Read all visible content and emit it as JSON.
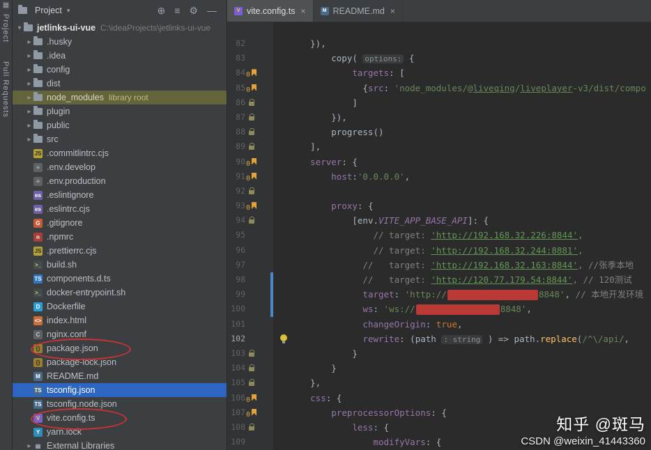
{
  "colors": {
    "sel": "#2d65c2",
    "olive": "#63633c",
    "vcs": "#4a88c7",
    "bm": "#e2a33a",
    "bulb": "#d9c13c",
    "redact": "#b93a34",
    "circle": "#cc3333"
  },
  "left_stripe": {
    "corner_glyph": "▦",
    "top_label": "Project",
    "bottom_label": "Pull Requests"
  },
  "project_panel": {
    "header": {
      "title": "Project",
      "dropdown_glyph": "▾",
      "icons": [
        {
          "name": "select-opened-file",
          "glyph": "⊕"
        },
        {
          "name": "collapse-all",
          "glyph": "≡"
        },
        {
          "name": "settings",
          "glyph": "⚙"
        },
        {
          "name": "hide-tool-window",
          "glyph": "—"
        }
      ]
    },
    "tree": [
      {
        "name": "jetlinks-ui-vue",
        "icon": "folder",
        "chevron": "down",
        "indent": 4,
        "bold": true,
        "path": "C:\\ideaProjects\\jetlinks-ui-vue"
      },
      {
        "name": ".husky",
        "icon": "folder",
        "chevron": "right",
        "indent": 18
      },
      {
        "name": ".idea",
        "icon": "folder",
        "chevron": "right",
        "indent": 18
      },
      {
        "name": "config",
        "icon": "folder",
        "chevron": "right",
        "indent": 18
      },
      {
        "name": "dist",
        "icon": "folder",
        "chevron": "right",
        "indent": 18
      },
      {
        "name": "node_modules",
        "icon": "folder",
        "chevron": "right",
        "indent": 18,
        "highlight": true,
        "suffix": "library root"
      },
      {
        "name": "plugin",
        "icon": "folder",
        "chevron": "right",
        "indent": 18
      },
      {
        "name": "public",
        "icon": "folder",
        "chevron": "right",
        "indent": 18
      },
      {
        "name": "src",
        "icon": "folder",
        "chevron": "right",
        "indent": 18
      },
      {
        "name": ".commitlintrc.cjs",
        "icon": "js",
        "indent": 18
      },
      {
        "name": ".env.develop",
        "icon": "env",
        "indent": 18
      },
      {
        "name": ".env.production",
        "icon": "env",
        "indent": 18
      },
      {
        "name": ".eslintignore",
        "icon": "eslint",
        "indent": 18
      },
      {
        "name": ".eslintrc.cjs",
        "icon": "eslint",
        "indent": 18
      },
      {
        "name": ".gitignore",
        "icon": "git",
        "indent": 18
      },
      {
        "name": ".npmrc",
        "icon": "npm",
        "indent": 18
      },
      {
        "name": ".prettierrc.cjs",
        "icon": "js",
        "indent": 18
      },
      {
        "name": "build.sh",
        "icon": "shell",
        "indent": 18
      },
      {
        "name": "components.d.ts",
        "icon": "ts",
        "indent": 18
      },
      {
        "name": "docker-entrypoint.sh",
        "icon": "shell",
        "indent": 18
      },
      {
        "name": "Dockerfile",
        "icon": "docker",
        "indent": 18
      },
      {
        "name": "index.html",
        "icon": "html",
        "indent": 18
      },
      {
        "name": "nginx.conf",
        "icon": "conf",
        "indent": 18
      },
      {
        "name": "package.json",
        "icon": "json",
        "indent": 18,
        "circled": true,
        "circle_width": 140
      },
      {
        "name": "package-lock.json",
        "icon": "json",
        "indent": 18
      },
      {
        "name": "README.md",
        "icon": "md",
        "indent": 18
      },
      {
        "name": "tsconfig.json",
        "icon": "tsconfig",
        "indent": 18,
        "selected": true
      },
      {
        "name": "tsconfig.node.json",
        "icon": "tsconfig",
        "indent": 18
      },
      {
        "name": "vite.config.ts",
        "icon": "vite",
        "indent": 18,
        "circled": true,
        "circle_width": 134
      },
      {
        "name": "yarn.lock",
        "icon": "yarn",
        "indent": 18
      },
      {
        "name": "External Libraries",
        "icon": "lib",
        "chevron": "right",
        "indent": 18
      }
    ]
  },
  "tab_bar": {
    "close_glyph": "×",
    "tabs": [
      {
        "label": "vite.config.ts",
        "icon": "vite",
        "active": true
      },
      {
        "label": "README.md",
        "icon": "md",
        "active": false
      }
    ]
  },
  "editor": {
    "bookmark_label": "0",
    "lines": [
      {
        "n": 82,
        "t": [
          [
            "p",
            "      }),"
          ]
        ]
      },
      {
        "n": 83,
        "t": [
          [
            "p",
            "          copy( "
          ],
          [
            "h",
            "options:"
          ],
          [
            "p",
            " {"
          ]
        ]
      },
      {
        "n": 84,
        "g": "bookmark",
        "t": [
          [
            "p",
            "              "
          ],
          [
            "f",
            "targets"
          ],
          [
            "p",
            ": ["
          ]
        ]
      },
      {
        "n": 85,
        "g": "bookmark",
        "t": [
          [
            "p",
            "                {"
          ],
          [
            "f",
            "src"
          ],
          [
            "p",
            ": "
          ],
          [
            "s",
            "'node_modules/@"
          ],
          [
            "su",
            "liveqing"
          ],
          [
            "s",
            "/"
          ],
          [
            "su",
            "liveplayer"
          ],
          [
            "s",
            "-v3/dist/compo"
          ]
        ]
      },
      {
        "n": 86,
        "g": "lock",
        "t": [
          [
            "p",
            "              ]"
          ]
        ]
      },
      {
        "n": 87,
        "g": "lock",
        "t": [
          [
            "p",
            "          }),"
          ]
        ]
      },
      {
        "n": 88,
        "g": "lock",
        "t": [
          [
            "p",
            "          progress()"
          ]
        ]
      },
      {
        "n": 89,
        "g": "lock",
        "t": [
          [
            "p",
            "      ],"
          ]
        ]
      },
      {
        "n": 90,
        "g": "bookmark",
        "t": [
          [
            "p",
            "      "
          ],
          [
            "f",
            "server"
          ],
          [
            "p",
            ": {"
          ]
        ]
      },
      {
        "n": 91,
        "g": "bookmark",
        "t": [
          [
            "p",
            "          "
          ],
          [
            "f",
            "host"
          ],
          [
            "p",
            ":"
          ],
          [
            "s",
            "'0.0.0.0'"
          ],
          [
            "p",
            ","
          ]
        ]
      },
      {
        "n": 92,
        "g": "lock",
        "t": []
      },
      {
        "n": 93,
        "g": "bookmark",
        "t": [
          [
            "p",
            "          "
          ],
          [
            "f",
            "proxy"
          ],
          [
            "p",
            ": {"
          ]
        ]
      },
      {
        "n": 94,
        "g": "lock",
        "t": [
          [
            "p",
            "              ["
          ],
          [
            "p",
            "env."
          ],
          [
            "fi",
            "VITE_APP_BASE_API"
          ],
          [
            "p",
            "]: {"
          ]
        ]
      },
      {
        "n": 95,
        "t": [
          [
            "c",
            "                  // target: "
          ],
          [
            "cu",
            "'http://192.168.32.226:8844'"
          ],
          [
            "c",
            ","
          ]
        ]
      },
      {
        "n": 96,
        "t": [
          [
            "c",
            "                  // target: "
          ],
          [
            "cu",
            "'http://192.168.32.244:8881'"
          ],
          [
            "c",
            ","
          ]
        ]
      },
      {
        "n": 97,
        "t": [
          [
            "c",
            "                //   target: "
          ],
          [
            "cu",
            "'http://192.168.32.163:8844'"
          ],
          [
            "c",
            ", //张季本地"
          ]
        ]
      },
      {
        "n": 98,
        "vcs": true,
        "t": [
          [
            "c",
            "                //   target: "
          ],
          [
            "cu",
            "'http://120.77.179.54:8844'"
          ],
          [
            "c",
            ", // 120测试"
          ]
        ]
      },
      {
        "n": 99,
        "vcs": true,
        "t": [
          [
            "p",
            "                "
          ],
          [
            "f",
            "target"
          ],
          [
            "p",
            ": "
          ],
          [
            "s",
            "'http://"
          ],
          [
            "r",
            "130"
          ],
          [
            "s",
            "8848'"
          ],
          [
            "p",
            ", "
          ],
          [
            "c",
            "// 本地开发环境"
          ]
        ]
      },
      {
        "n": 100,
        "vcs": true,
        "t": [
          [
            "p",
            "                "
          ],
          [
            "f",
            "ws"
          ],
          [
            "p",
            ": "
          ],
          [
            "s",
            "'ws://"
          ],
          [
            "r",
            "120"
          ],
          [
            "s",
            "8848'"
          ],
          [
            "p",
            ","
          ]
        ]
      },
      {
        "n": 101,
        "t": [
          [
            "p",
            "                "
          ],
          [
            "f",
            "changeOrigin"
          ],
          [
            "p",
            ": "
          ],
          [
            "k",
            "true"
          ],
          [
            "p",
            ","
          ]
        ]
      },
      {
        "n": 102,
        "g": "bulb",
        "cur": true,
        "t": [
          [
            "p",
            "                "
          ],
          [
            "f",
            "rewrite"
          ],
          [
            "p",
            ": ("
          ],
          [
            "p",
            "path "
          ],
          [
            "t",
            ": string"
          ],
          [
            "p",
            " ) => path."
          ],
          [
            "m",
            "replace"
          ],
          [
            "p",
            "("
          ],
          [
            "s",
            "/^\\/api/"
          ],
          [
            "p",
            ", "
          ]
        ]
      },
      {
        "n": 103,
        "g": "lock",
        "t": [
          [
            "p",
            "              }"
          ]
        ]
      },
      {
        "n": 104,
        "g": "lock",
        "t": [
          [
            "p",
            "          }"
          ]
        ]
      },
      {
        "n": 105,
        "g": "lock",
        "t": [
          [
            "p",
            "      },"
          ]
        ]
      },
      {
        "n": 106,
        "g": "bookmark",
        "t": [
          [
            "p",
            "      "
          ],
          [
            "f",
            "css"
          ],
          [
            "p",
            ": {"
          ]
        ]
      },
      {
        "n": 107,
        "g": "bookmark",
        "t": [
          [
            "p",
            "          "
          ],
          [
            "f",
            "preprocessorOptions"
          ],
          [
            "p",
            ": {"
          ]
        ]
      },
      {
        "n": 108,
        "g": "lock",
        "t": [
          [
            "p",
            "              "
          ],
          [
            "f",
            "less"
          ],
          [
            "p",
            ": {"
          ]
        ]
      },
      {
        "n": 109,
        "t": [
          [
            "p",
            "                  "
          ],
          [
            "f",
            "modifyVars"
          ],
          [
            "p",
            ": {"
          ]
        ]
      }
    ]
  },
  "icon_styles": {
    "js": {
      "glyph": "JS",
      "bg": "#b3a135",
      "fg": "#2b2b2b"
    },
    "env": {
      "glyph": "≡",
      "bg": "#5f6265",
      "fg": "#c7cbd0"
    },
    "eslint": {
      "glyph": "es",
      "bg": "#6f5fa6",
      "fg": "#ffffff"
    },
    "git": {
      "glyph": "G",
      "bg": "#c75b39",
      "fg": "#ffffff"
    },
    "npm": {
      "glyph": "n",
      "bg": "#a8403a",
      "fg": "#ffffff"
    },
    "shell": {
      "glyph": ">_",
      "bg": "#47494b",
      "fg": "#9fe08a"
    },
    "ts": {
      "glyph": "TS",
      "bg": "#3178c6",
      "fg": "#ffffff"
    },
    "docker": {
      "glyph": "D",
      "bg": "#2d9fd8",
      "fg": "#ffffff"
    },
    "html": {
      "glyph": "<>",
      "bg": "#c96f3b",
      "fg": "#ffffff"
    },
    "conf": {
      "glyph": "C",
      "bg": "#5f6265",
      "fg": "#c7cbd0"
    },
    "json": {
      "glyph": "{}",
      "bg": "#9a7f2f",
      "fg": "#2b2b2b"
    },
    "md": {
      "glyph": "M",
      "bg": "#4a6b8a",
      "fg": "#ffffff"
    },
    "tsconfig": {
      "glyph": "TS",
      "bg": "#456a8c",
      "fg": "#ffffff"
    },
    "vite": {
      "glyph": "V",
      "bg": "#7a5fd0",
      "fg": "#ffd62e"
    },
    "yarn": {
      "glyph": "Y",
      "bg": "#2c8ebb",
      "fg": "#ffffff"
    },
    "lib": {
      "glyph": "▤",
      "bg": "transparent",
      "fg": "#a9b7c6"
    }
  },
  "watermark": {
    "zhihu": "知乎 @斑马",
    "csdn": "CSDN @weixin_41443360"
  }
}
